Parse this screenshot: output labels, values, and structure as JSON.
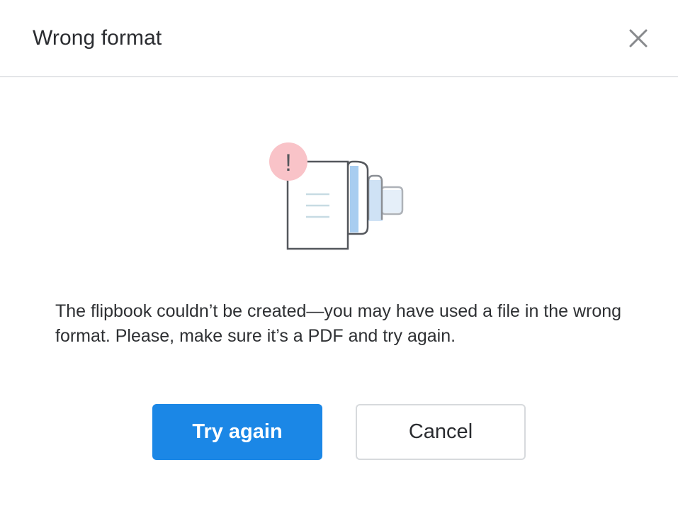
{
  "dialog": {
    "title": "Wrong format",
    "message": "The flipbook couldn’t be created—you may have used a file in the wrong format. Please, make sure it’s a PDF and try again.",
    "alert_mark": "!"
  },
  "buttons": {
    "try_again_label": "Try again",
    "cancel_label": "Cancel"
  },
  "icons": {
    "close": "close-icon",
    "illustration": "flipbook-error-illustration"
  },
  "colors": {
    "primary": "#1b87e6",
    "alert_badge": "#f9c3c8",
    "page_accent": "#a8cdf0",
    "text": "#2a2c30",
    "divider": "#e3e5e8"
  }
}
